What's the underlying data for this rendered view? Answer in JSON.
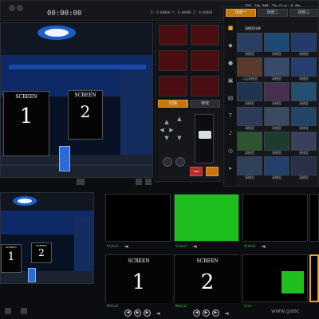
{
  "status_bar": {
    "timecode": "00:00:00",
    "readout": "X: 0.00000  Y: 0.00000  Z: 0.00000",
    "meters": "CPU: 20%   RAM: 32%   Disk: 0.48%"
  },
  "studio": {
    "screen_label": "SCREEN",
    "screen1_num": "1",
    "screen2_num": "2"
  },
  "controls": {
    "tab_left": "切换",
    "tab_right": "特效",
    "tbar_btn_label": "TAKE"
  },
  "gallery": {
    "tabs": [
      "场景一",
      "场景二",
      "场景三"
    ],
    "section_header": "演播室场景",
    "captions": [
      "演播室",
      "演播室",
      "演播室",
      "二层演播室",
      "演播室",
      "演播室",
      "演播室",
      "演播室",
      "演播室",
      "演播室",
      "演播室",
      "演播室",
      "演播室",
      "演播室",
      "演播室",
      "演播室",
      "演播室",
      "演播室"
    ],
    "colors": [
      "#2a3d63",
      "#1d4a74",
      "#243a6a",
      "#5a3a2a",
      "#3a4a6a",
      "#263e6e",
      "#1e3550",
      "#4a3050",
      "#245070",
      "#2d3a58",
      "#3a4a60",
      "#224466",
      "#2f5530",
      "#1f3a2f",
      "#3a3f5a",
      "#30405a",
      "#253f6b",
      "#2a2f48"
    ]
  },
  "monitors": {
    "labels": [
      "Video1",
      "Video2",
      "Video3",
      "Media1",
      "Media2",
      "Live"
    ],
    "green_color": "#1fbf1f"
  },
  "watermark": "www.gaoc"
}
